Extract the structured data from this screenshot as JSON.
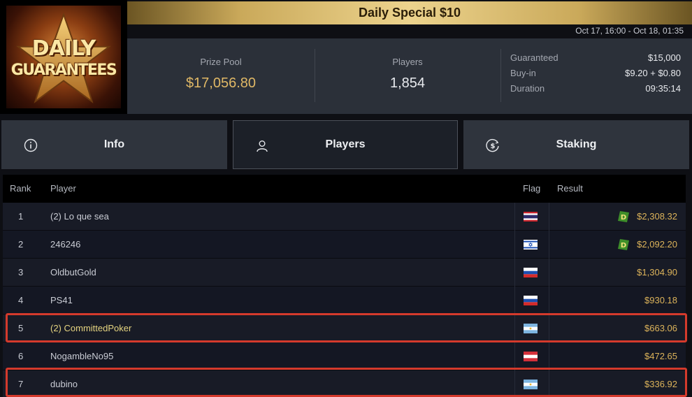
{
  "logo": {
    "line1": "DAILY",
    "line2": "GUARANTEES"
  },
  "header": {
    "title": "Daily Special $10",
    "date_range": "Oct 17, 16:00 - Oct 18, 01:35"
  },
  "stats": {
    "prize_pool_label": "Prize Pool",
    "prize_pool_value": "$17,056.80",
    "players_label": "Players",
    "players_value": "1,854",
    "details": [
      {
        "label": "Guaranteed",
        "value": "$15,000"
      },
      {
        "label": "Buy-in",
        "value": "$9.20 + $0.80"
      },
      {
        "label": "Duration",
        "value": "09:35:14"
      }
    ]
  },
  "tabs": [
    {
      "label": "Info",
      "icon": "info-icon",
      "active": false
    },
    {
      "label": "Players",
      "icon": "user-icon",
      "active": true
    },
    {
      "label": "Staking",
      "icon": "dollar-coin-icon",
      "active": false
    }
  ],
  "table": {
    "headers": {
      "rank": "Rank",
      "player": "Player",
      "flag": "Flag",
      "result": "Result"
    },
    "rows": [
      {
        "rank": "1",
        "player": "(2) Lo que sea",
        "flag": "thailand",
        "result": "$2,308.32",
        "badge": "D",
        "highlighted": false
      },
      {
        "rank": "2",
        "player": "246246",
        "flag": "israel",
        "result": "$2,092.20",
        "badge": "D",
        "highlighted": false
      },
      {
        "rank": "3",
        "player": "OldbutGold",
        "flag": "russia",
        "result": "$1,304.90",
        "badge": "",
        "highlighted": false
      },
      {
        "rank": "4",
        "player": "PS41",
        "flag": "russia",
        "result": "$930.18",
        "badge": "",
        "highlighted": false
      },
      {
        "rank": "5",
        "player": "(2) CommittedPoker",
        "flag": "argentina",
        "result": "$663.06",
        "badge": "",
        "highlighted": true
      },
      {
        "rank": "6",
        "player": "NogambleNo95",
        "flag": "austria",
        "result": "$472.65",
        "badge": "",
        "highlighted": false
      },
      {
        "rank": "7",
        "player": "dubino",
        "flag": "argentina",
        "result": "$336.92",
        "badge": "",
        "highlighted": false
      }
    ]
  },
  "colors": {
    "gold": "#e0b866",
    "result": "#dcb35a",
    "highlight_border": "#d43a2c",
    "badge_green": "#3f8f2a"
  }
}
